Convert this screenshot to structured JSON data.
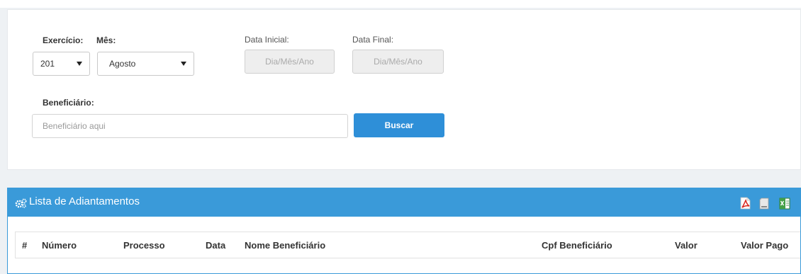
{
  "filters": {
    "exercicio": {
      "label": "Exercício:",
      "value": "201"
    },
    "mes": {
      "label": "Mês:",
      "value": "Agosto"
    },
    "data_inicial": {
      "label": "Data Inicial:",
      "placeholder": "Dia/Mês/Ano"
    },
    "data_final": {
      "label": "Data Final:",
      "placeholder": "Dia/Mês/Ano"
    },
    "beneficiario": {
      "label": "Beneficiário:",
      "placeholder": "Beneficiário aqui"
    },
    "search_button": "Buscar"
  },
  "list": {
    "title": "Lista de Adiantamentos",
    "header_icon": "gears-icon",
    "actions": [
      "pdf-export-icon",
      "document-export-icon",
      "excel-export-icon"
    ],
    "columns": [
      "#",
      "Número",
      "Processo",
      "Data",
      "Nome Beneficiário",
      "Cpf Beneficiário",
      "Valor",
      "Valor Pago"
    ]
  },
  "colors": {
    "accent": "#3a9ad9",
    "button": "#2e8fd8",
    "page_background": "#eef1f4"
  }
}
